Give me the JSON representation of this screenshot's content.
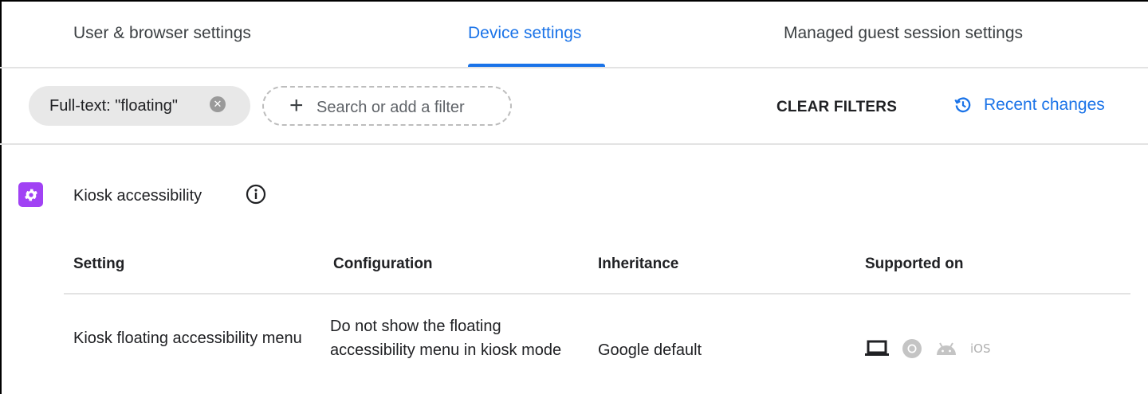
{
  "tabs": [
    {
      "label": "User & browser settings",
      "active": false
    },
    {
      "label": "Device settings",
      "active": true
    },
    {
      "label": "Managed guest session settings",
      "active": false
    }
  ],
  "filters": {
    "chip_label": "Full-text: \"floating\"",
    "search_placeholder": "Search or add a filter",
    "clear_label": "CLEAR FILTERS",
    "recent_label": "Recent changes"
  },
  "section": {
    "title": "Kiosk accessibility",
    "icon": "gear-icon",
    "icon_color": "#a142f4"
  },
  "table": {
    "headers": [
      "Setting",
      "Configuration",
      "Inheritance",
      "Supported on"
    ],
    "rows": [
      {
        "setting": "Kiosk floating accessibility menu",
        "configuration": "Do not show the floating accessibility menu in kiosk mode",
        "inheritance": "Google default",
        "platforms": [
          {
            "icon": "laptop-icon",
            "supported": true
          },
          {
            "icon": "chrome-icon",
            "supported": false
          },
          {
            "icon": "android-icon",
            "supported": false
          },
          {
            "label": "iOS",
            "supported": false
          }
        ]
      }
    ]
  },
  "colors": {
    "accent": "#1a73e8",
    "chip_bg": "#e8e8e8",
    "section_icon": "#a142f4"
  }
}
